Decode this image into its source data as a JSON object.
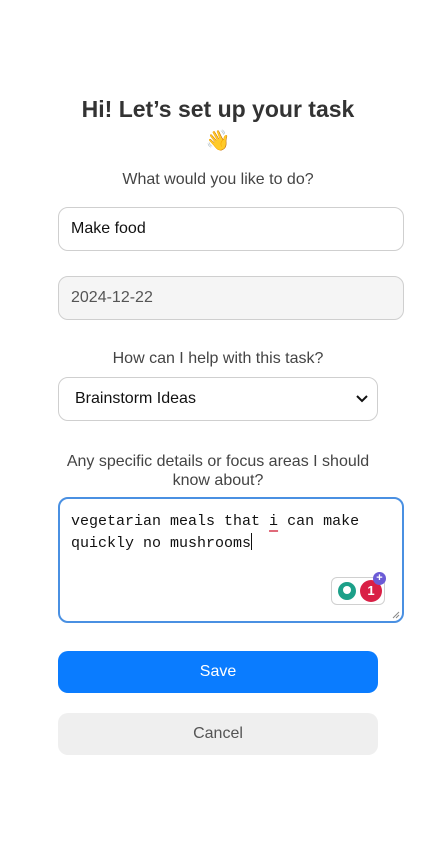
{
  "header": {
    "title": "Hi! Let’s set up your task",
    "wave_emoji": "👋",
    "subtitle": "What would you like to do?"
  },
  "form": {
    "task_value": "Make food",
    "date_value": "2024-12-22",
    "help_label": "How can I help with this task?",
    "help_selected": "Brainstorm Ideas",
    "details_label": "Any specific details or focus areas I should know about?",
    "details_text_before": "vegetarian meals that ",
    "details_text_flagged": "i",
    "details_text_after": " can make quickly no mushrooms",
    "grammar_badge_count": "1",
    "grammar_badge_plus": "+"
  },
  "actions": {
    "save_label": "Save",
    "cancel_label": "Cancel"
  },
  "colors": {
    "accent": "#0a7cff",
    "focus_border": "#4a90e2",
    "cancel_bg": "#efefef"
  }
}
